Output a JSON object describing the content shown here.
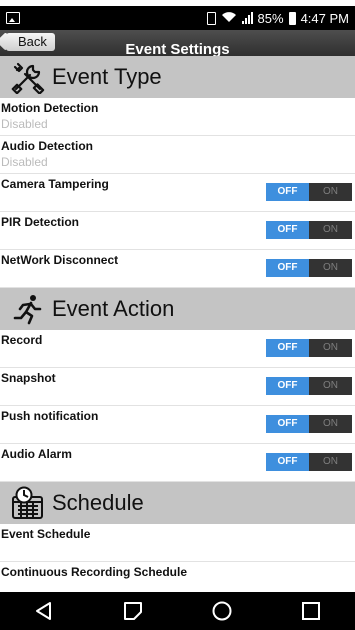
{
  "status_bar": {
    "battery": "85%",
    "time": "4:47 PM"
  },
  "header": {
    "back_label": "Back",
    "title": "Event Settings"
  },
  "sections": {
    "event_type": {
      "title": "Event Type",
      "icon": "tools-icon",
      "rows": [
        {
          "label": "Motion Detection",
          "sub": "Disabled"
        },
        {
          "label": "Audio Detection",
          "sub": "Disabled"
        },
        {
          "label": "Camera Tampering",
          "off": "OFF",
          "on": "ON"
        },
        {
          "label": "PIR Detection",
          "off": "OFF",
          "on": "ON"
        },
        {
          "label": "NetWork Disconnect",
          "off": "OFF",
          "on": "ON"
        }
      ]
    },
    "event_action": {
      "title": "Event Action",
      "icon": "running-person-icon",
      "rows": [
        {
          "label": "Record",
          "off": "OFF",
          "on": "ON"
        },
        {
          "label": "Snapshot",
          "off": "OFF",
          "on": "ON"
        },
        {
          "label": "Push notification",
          "off": "OFF",
          "on": "ON"
        },
        {
          "label": "Audio Alarm",
          "off": "OFF",
          "on": "ON"
        }
      ]
    },
    "schedule": {
      "title": "Schedule",
      "icon": "calendar-clock-icon",
      "rows": [
        {
          "label": "Event Schedule"
        },
        {
          "label": "Continuous Recording Schedule"
        }
      ]
    }
  },
  "colors": {
    "toggle_off_active": "#3e8fde",
    "toggle_on_inactive": "#333333",
    "section_bg": "#c4c4c4"
  }
}
